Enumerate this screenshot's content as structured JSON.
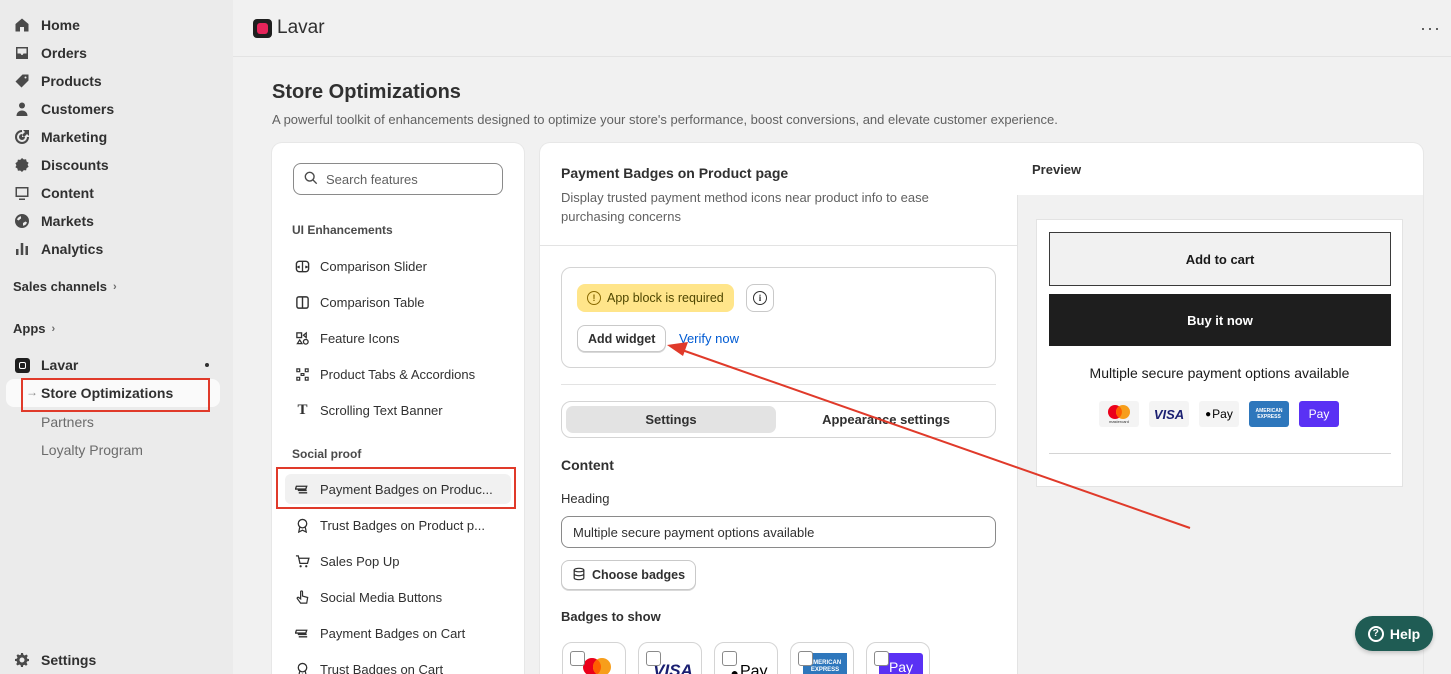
{
  "sidebar": {
    "items": [
      {
        "label": "Home",
        "icon": "home-icon"
      },
      {
        "label": "Orders",
        "icon": "inbox-icon"
      },
      {
        "label": "Products",
        "icon": "tag-icon"
      },
      {
        "label": "Customers",
        "icon": "person-icon"
      },
      {
        "label": "Marketing",
        "icon": "target-icon"
      },
      {
        "label": "Discounts",
        "icon": "discount-icon"
      },
      {
        "label": "Content",
        "icon": "content-icon"
      },
      {
        "label": "Markets",
        "icon": "globe-icon"
      },
      {
        "label": "Analytics",
        "icon": "bar-chart-icon"
      }
    ],
    "sales_channels": "Sales channels",
    "apps": "Apps",
    "app_name": "Lavar",
    "sub_items": {
      "active": "Store Optimizations",
      "partners": "Partners",
      "loyalty": "Loyalty Program"
    },
    "settings": "Settings"
  },
  "topbar": {
    "app_title": "Lavar",
    "more": "···"
  },
  "page": {
    "title": "Store Optimizations",
    "description": "A powerful toolkit of enhancements designed to optimize your store's performance, boost conversions, and elevate customer experience."
  },
  "features": {
    "search_placeholder": "Search features",
    "groups": [
      {
        "label": "UI Enhancements",
        "items": [
          {
            "label": "Comparison Slider",
            "icon": "comparison-slider-icon"
          },
          {
            "label": "Comparison Table",
            "icon": "comparison-table-icon"
          },
          {
            "label": "Feature Icons",
            "icon": "feature-icons-icon"
          },
          {
            "label": "Product Tabs & Accordions",
            "icon": "tabs-accordions-icon"
          },
          {
            "label": "Scrolling Text Banner",
            "icon": "text-icon"
          }
        ]
      },
      {
        "label": "Social proof",
        "items": [
          {
            "label": "Payment Badges on Produc...",
            "icon": "payment-badges-icon"
          },
          {
            "label": "Trust Badges on Product p...",
            "icon": "trust-badge-icon"
          },
          {
            "label": "Sales Pop Up",
            "icon": "cart-icon"
          },
          {
            "label": "Social Media Buttons",
            "icon": "social-media-icon"
          },
          {
            "label": "Payment Badges on Cart",
            "icon": "payment-badges-icon"
          },
          {
            "label": "Trust Badges on Cart",
            "icon": "trust-badge-icon"
          }
        ]
      }
    ]
  },
  "settings_panel": {
    "title": "Payment Badges on Product page",
    "description": "Display trusted payment method icons near product info to ease purchasing concerns",
    "warning": "App block is required",
    "add_widget": "Add widget",
    "verify_now": "Verify now",
    "tabs": [
      "Settings",
      "Appearance settings"
    ],
    "content_label": "Content",
    "heading_label": "Heading",
    "heading_value": "Multiple secure payment options available",
    "choose_badges": "Choose badges",
    "badges_label": "Badges to show",
    "badges": [
      {
        "name": "mastercard",
        "text": ""
      },
      {
        "name": "visa",
        "text": "VISA"
      },
      {
        "name": "apple-pay",
        "text": "Pay"
      },
      {
        "name": "american-express",
        "text": "AMERICAN EXPRESS"
      },
      {
        "name": "shop-pay",
        "text": "Pay"
      }
    ]
  },
  "preview": {
    "label": "Preview",
    "add_to_cart": "Add to cart",
    "buy_now": "Buy it now",
    "message": "Multiple secure payment options available",
    "badges": [
      {
        "name": "mastercard",
        "text": "mastercard"
      },
      {
        "name": "visa",
        "text": "VISA"
      },
      {
        "name": "apple-pay",
        "text": "Pay"
      },
      {
        "name": "american-express",
        "text": "AMERICAN EXPRESS"
      },
      {
        "name": "shop-pay",
        "text": "Pay"
      }
    ]
  },
  "help": {
    "label": "Help"
  },
  "colors": {
    "annotation_red": "#e03a2a",
    "warning_bg": "#ffe58a",
    "link_blue": "#005bd3",
    "help_green": "#1f5c54"
  }
}
